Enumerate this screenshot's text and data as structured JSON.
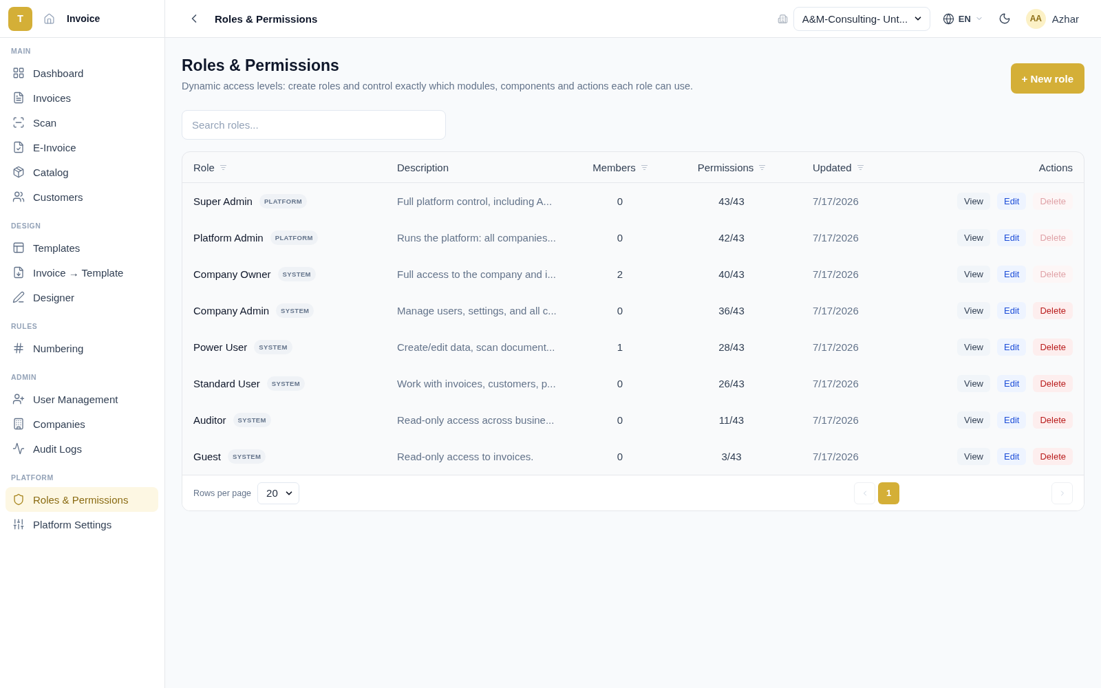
{
  "sidebar": {
    "logo": "T",
    "app_name": "Invoice",
    "sections": [
      {
        "label": "MAIN",
        "items": [
          {
            "label": "Dashboard",
            "selected": false
          },
          {
            "label": "Invoices",
            "selected": false
          },
          {
            "label": "Scan",
            "selected": false
          },
          {
            "label": "E-Invoice",
            "selected": false
          },
          {
            "label": "Catalog",
            "selected": false
          },
          {
            "label": "Customers",
            "selected": false
          }
        ]
      },
      {
        "label": "DESIGN",
        "items": [
          {
            "label": "Templates",
            "selected": false
          },
          {
            "label": "Invoice → Template",
            "selected": false
          },
          {
            "label": "Designer",
            "selected": false
          }
        ]
      },
      {
        "label": "RULES",
        "items": [
          {
            "label": "Numbering",
            "selected": false
          }
        ]
      },
      {
        "label": "ADMIN",
        "items": [
          {
            "label": "User Management",
            "selected": false
          },
          {
            "label": "Companies",
            "selected": false
          },
          {
            "label": "Audit Logs",
            "selected": false
          }
        ]
      },
      {
        "label": "PLATFORM",
        "items": [
          {
            "label": "Roles & Permissions",
            "selected": true
          },
          {
            "label": "Platform Settings",
            "selected": false
          }
        ]
      }
    ]
  },
  "topbar": {
    "title": "Roles & Permissions",
    "company": "A&M-Consulting- Unt...",
    "language": "EN",
    "user": {
      "initials": "AA",
      "name": "Azhar"
    }
  },
  "page": {
    "title": "Roles & Permissions",
    "subtitle": "Dynamic access levels: create roles and control exactly which modules, components and actions each role can use.",
    "new_button": "+ New role",
    "search": {
      "placeholder": "Search roles..."
    }
  },
  "table": {
    "columns": [
      {
        "label": "Role",
        "sortable": true
      },
      {
        "label": "Description",
        "sortable": false
      },
      {
        "label": "Members",
        "sortable": true
      },
      {
        "label": "Permissions",
        "sortable": true
      },
      {
        "label": "Updated",
        "sortable": true
      },
      {
        "label": "Actions",
        "sortable": false
      }
    ],
    "rows": [
      {
        "role": "Super Admin",
        "badge": "PLATFORM",
        "description": "Full platform control, including A...",
        "members": "0",
        "permissions": "43/43",
        "updated": "7/17/2026",
        "actions": [
          {
            "label": "View",
            "kind": "view",
            "disabled": false
          },
          {
            "label": "Edit",
            "kind": "edit",
            "disabled": false
          },
          {
            "label": "Delete",
            "kind": "delete",
            "disabled": true
          }
        ]
      },
      {
        "role": "Platform Admin",
        "badge": "PLATFORM",
        "description": "Runs the platform: all companies...",
        "members": "0",
        "permissions": "42/43",
        "updated": "7/17/2026",
        "actions": [
          {
            "label": "View",
            "kind": "view",
            "disabled": false
          },
          {
            "label": "Edit",
            "kind": "edit",
            "disabled": false
          },
          {
            "label": "Delete",
            "kind": "delete",
            "disabled": true
          }
        ]
      },
      {
        "role": "Company Owner",
        "badge": "SYSTEM",
        "description": "Full access to the company and i...",
        "members": "2",
        "permissions": "40/43",
        "updated": "7/17/2026",
        "actions": [
          {
            "label": "View",
            "kind": "view",
            "disabled": false
          },
          {
            "label": "Edit",
            "kind": "edit",
            "disabled": false
          },
          {
            "label": "Delete",
            "kind": "delete",
            "disabled": true
          }
        ]
      },
      {
        "role": "Company Admin",
        "badge": "SYSTEM",
        "description": "Manage users, settings, and all c...",
        "members": "0",
        "permissions": "36/43",
        "updated": "7/17/2026",
        "actions": [
          {
            "label": "View",
            "kind": "view",
            "disabled": false
          },
          {
            "label": "Edit",
            "kind": "edit",
            "disabled": false
          },
          {
            "label": "Delete",
            "kind": "delete",
            "disabled": false
          }
        ]
      },
      {
        "role": "Power User",
        "badge": "SYSTEM",
        "description": "Create/edit data, scan document...",
        "members": "1",
        "permissions": "28/43",
        "updated": "7/17/2026",
        "actions": [
          {
            "label": "View",
            "kind": "view",
            "disabled": false
          },
          {
            "label": "Edit",
            "kind": "edit",
            "disabled": false
          },
          {
            "label": "Delete",
            "kind": "delete",
            "disabled": false
          }
        ]
      },
      {
        "role": "Standard User",
        "badge": "SYSTEM",
        "description": "Work with invoices, customers, p...",
        "members": "0",
        "permissions": "26/43",
        "updated": "7/17/2026",
        "actions": [
          {
            "label": "View",
            "kind": "view",
            "disabled": false
          },
          {
            "label": "Edit",
            "kind": "edit",
            "disabled": false
          },
          {
            "label": "Delete",
            "kind": "delete",
            "disabled": false
          }
        ]
      },
      {
        "role": "Auditor",
        "badge": "SYSTEM",
        "description": "Read-only access across busine...",
        "members": "0",
        "permissions": "11/43",
        "updated": "7/17/2026",
        "actions": [
          {
            "label": "View",
            "kind": "view",
            "disabled": false
          },
          {
            "label": "Edit",
            "kind": "edit",
            "disabled": false
          },
          {
            "label": "Delete",
            "kind": "delete",
            "disabled": false
          }
        ]
      },
      {
        "role": "Guest",
        "badge": "SYSTEM",
        "description": "Read-only access to invoices.",
        "members": "0",
        "permissions": "3/43",
        "updated": "7/17/2026",
        "actions": [
          {
            "label": "View",
            "kind": "view",
            "disabled": false
          },
          {
            "label": "Edit",
            "kind": "edit",
            "disabled": false
          },
          {
            "label": "Delete",
            "kind": "delete",
            "disabled": false
          }
        ]
      }
    ]
  },
  "pagination": {
    "rows_per_page_label": "Rows per page",
    "rows_per_page": "20",
    "previous_disabled": true,
    "pages": [
      {
        "label": "1",
        "selected": true
      }
    ],
    "next_disabled": true
  }
}
